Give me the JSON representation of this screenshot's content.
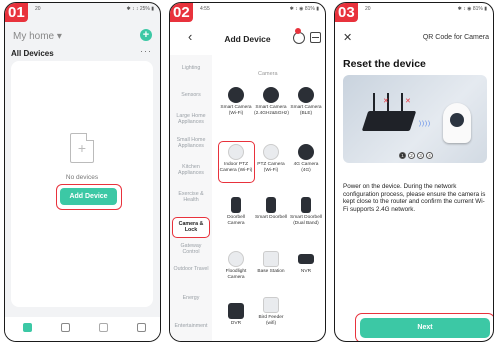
{
  "phone1": {
    "step": "01",
    "status_time": "20",
    "status_right": "✱ ↕ ↕ 25% ▮",
    "home_label": "My home",
    "home_caret": "▾",
    "add_icon": "+",
    "all_devices": "All Devices",
    "more_icon": "···",
    "empty_text": "No devices",
    "add_device_button": "Add Device",
    "colors": {
      "accent": "#3cc8a5",
      "highlight": "#e8323c"
    }
  },
  "phone2": {
    "step": "02",
    "status_time": "4:55",
    "status_right": "✱ ↕ ◉ 81% ▮",
    "back_icon": "‹",
    "title": "Add Device",
    "categories": [
      "Lighting",
      "Sensors",
      "Large Home Appliances",
      "Small Home Appliances",
      "Kitchen Appliances",
      "Exercise & Health",
      "Camera & Lock",
      "Gateway Control",
      "Outdoor Travel",
      "Energy",
      "Entertainment"
    ],
    "section_title": "Camera",
    "devices": [
      "Smart Camera (Wi-Fi)",
      "Smart Camera (2.4GHz&5GHz)",
      "Smart Camera (BLE)",
      "Indoor PTZ Camera (Wi-Fi)",
      "PTZ Camera (Wi-Fi)",
      "4G Camera (4G)",
      "Doorbell Camera",
      "Smart Doorbell",
      "Smart Doorbell (Dual Band)",
      "Floodlight Camera",
      "Base Station",
      "NVR",
      "DVR",
      "Bird Feeder (wifi)"
    ]
  },
  "phone3": {
    "step": "03",
    "status_time": "20",
    "status_right": "✱ ↕ ◉ 81% ▮",
    "close_icon": "✕",
    "title": "QR Code for Camera",
    "heading": "Reset the device",
    "pager": [
      "1",
      "2",
      "3",
      "4"
    ],
    "instructions": "Power on the device. During the network configuration process, please ensure the camera is kept close to the router and confirm the current Wi-Fi supports 2.4G network.",
    "next_button": "Next"
  }
}
